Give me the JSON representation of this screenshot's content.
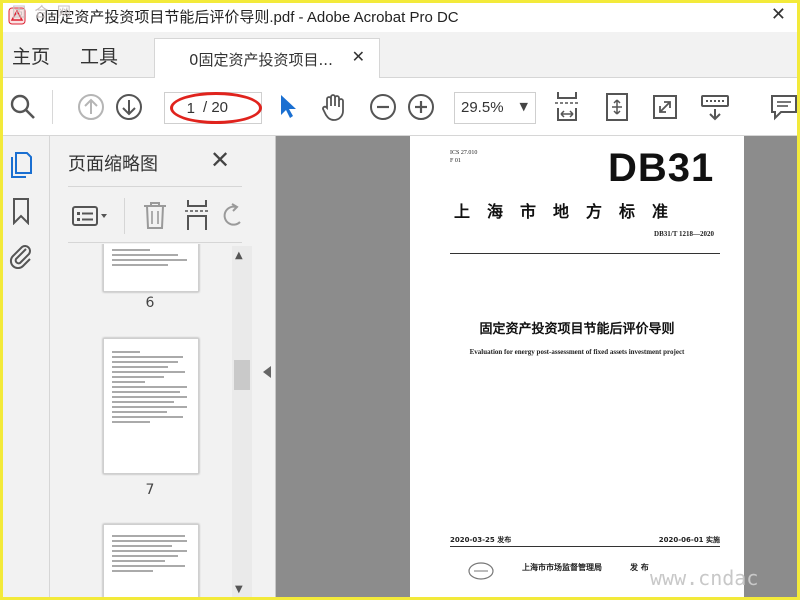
{
  "window": {
    "title": "0固定资产投资项目节能后评价导则.pdf - Adobe Acrobat Pro DC",
    "close_glyph": "✕",
    "watermark_top": "固 合 网"
  },
  "tabs": {
    "home": "主页",
    "tools": "工具",
    "document": "0固定资产投资项目...",
    "document_close": "✕"
  },
  "toolbar": {
    "current_page": "1",
    "total_pages": "/ 20",
    "zoom": "29.5%",
    "zoom_caret": "▼"
  },
  "thumbnail_panel": {
    "title": "页面缩略图",
    "close_glyph": "✕",
    "pages": [
      {
        "number": "6"
      },
      {
        "number": "7"
      },
      {
        "number": ""
      }
    ]
  },
  "document_page": {
    "ics": "ICS 27.010",
    "ccs": "F 01",
    "logo": "DB31",
    "org": "上海市地方标准",
    "code": "DB31/T 1218—2020",
    "title": "固定资产投资项目节能后评价导则",
    "subtitle": "Evaluation for energy post-assessment of fixed assets investment project",
    "issue_date": "2020-03-25 发布",
    "effective_date": "2020-06-01 实施",
    "issuer": "上海市市场监督管理局",
    "publish_word": "发 布"
  },
  "watermark_bottom": "www.cndac",
  "colors": {
    "accent_blue": "#1a6fd1",
    "annotation_red": "#e0231d",
    "frame_yellow": "#f3ea3a"
  }
}
